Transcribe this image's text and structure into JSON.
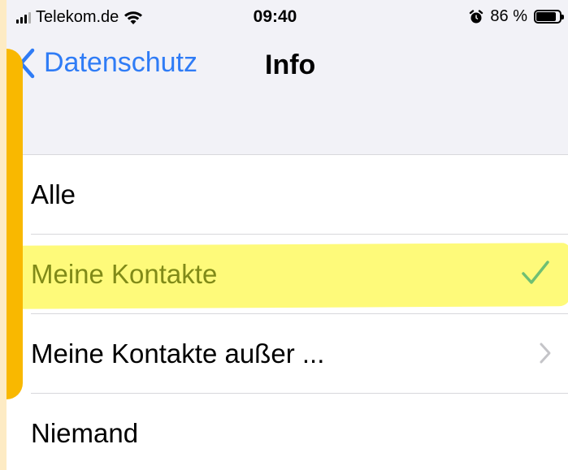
{
  "status_bar": {
    "carrier": "Telekom.de",
    "time": "09:40",
    "battery_percent": "86 %",
    "battery_level": 0.86
  },
  "nav": {
    "back_label": "Datenschutz",
    "title": "Info"
  },
  "options": [
    {
      "label": "Alle",
      "selected": false,
      "accessory": "none"
    },
    {
      "label": "Meine Kontakte",
      "selected": true,
      "accessory": "checkmark-icon"
    },
    {
      "label": "Meine Kontakte außer ...",
      "selected": false,
      "accessory": "chevron-right-icon"
    },
    {
      "label": "Niemand",
      "selected": false,
      "accessory": "none"
    }
  ],
  "colors": {
    "ios_blue": "#2f7cf6",
    "checkmark_green": "#6fbf73",
    "highlighter_yellow": "#fefa7a",
    "annotation_orange": "#f9b800"
  }
}
